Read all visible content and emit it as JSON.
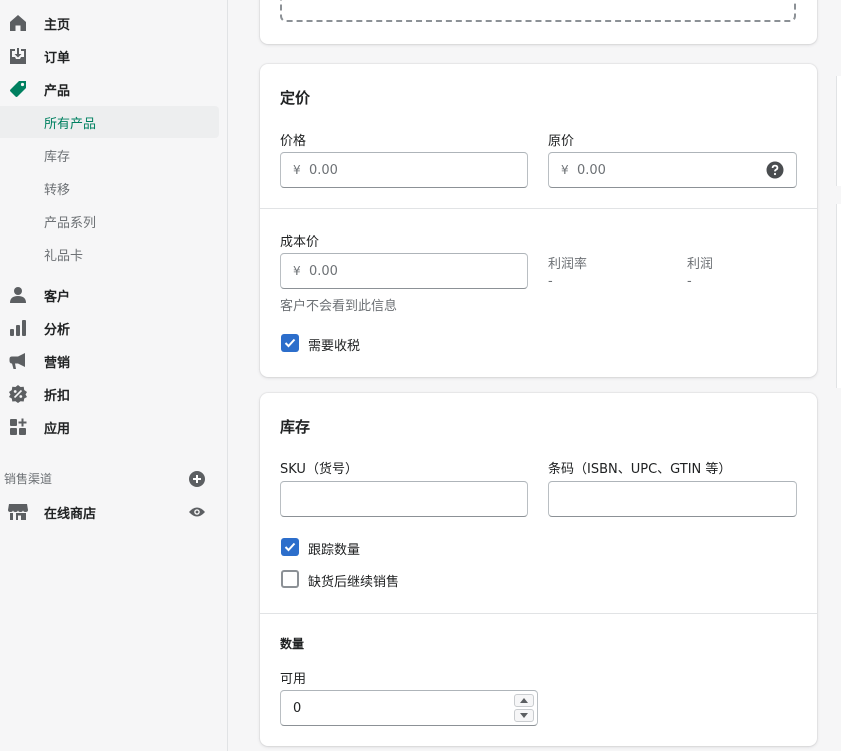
{
  "nav": {
    "home": "主页",
    "orders": "订单",
    "products": "产品",
    "products_sub": [
      "所有产品",
      "库存",
      "转移",
      "产品系列",
      "礼品卡"
    ],
    "customers": "客户",
    "analytics": "分析",
    "marketing": "营销",
    "discounts": "折扣",
    "apps": "应用",
    "sales_channels_label": "销售渠道",
    "online_store": "在线商店"
  },
  "pricing": {
    "title": "定价",
    "price_label": "价格",
    "compare_label": "原价",
    "currency": "¥",
    "price_value": "0.00",
    "compare_value": "0.00",
    "cost_label": "成本价",
    "cost_value": "0.00",
    "cost_help": "客户不会看到此信息",
    "margin_label": "利润率",
    "margin_value": "-",
    "profit_label": "利润",
    "profit_value": "-",
    "charge_tax_label": "需要收税",
    "charge_tax": true
  },
  "inventory": {
    "title": "库存",
    "sku_label": "SKU（货号）",
    "barcode_label": "条码（ISBN、UPC、GTIN 等）",
    "sku_value": "",
    "barcode_value": "",
    "track_label": "跟踪数量",
    "track": true,
    "continue_label": "缺货后继续销售",
    "continue": false,
    "quantity_title": "数量",
    "available_label": "可用",
    "available_value": "0"
  },
  "colors": {
    "accent": "#008060",
    "checkbox": "#2c6ecb"
  }
}
